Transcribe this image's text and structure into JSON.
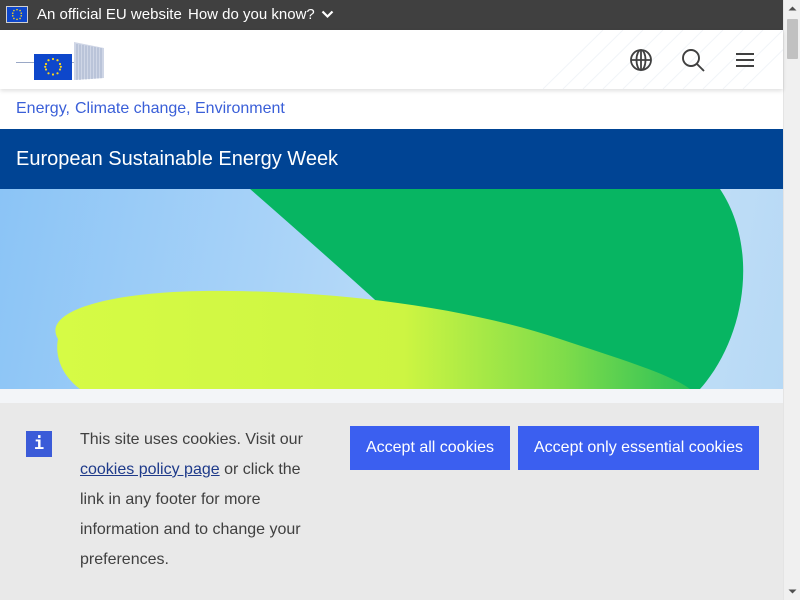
{
  "eu_bar": {
    "official_label": "An official EU website",
    "how_do_you_know_label": "How do you know?"
  },
  "header": {
    "logo_alt": "European Commission",
    "icons": [
      "globe-icon",
      "search-icon",
      "menu-icon"
    ]
  },
  "breadcrumb": {
    "items": [
      "Energy,",
      "Climate change,",
      "Environment"
    ]
  },
  "page": {
    "title": "European Sustainable Energy Week"
  },
  "cookie_banner": {
    "text_before_link": "This site uses cookies. Visit our ",
    "link_text": "cookies policy page",
    "text_after_link": " or click the link in any footer for more information and to change your preferences.",
    "accept_all_label": "Accept all cookies",
    "accept_essential_label": "Accept only essential cookies"
  },
  "colors": {
    "eu_bar": "#404040",
    "title_band": "#004494",
    "button": "#3b5ff0",
    "link": "#3a5fd8",
    "cookie_bg": "#e9e9e9"
  }
}
